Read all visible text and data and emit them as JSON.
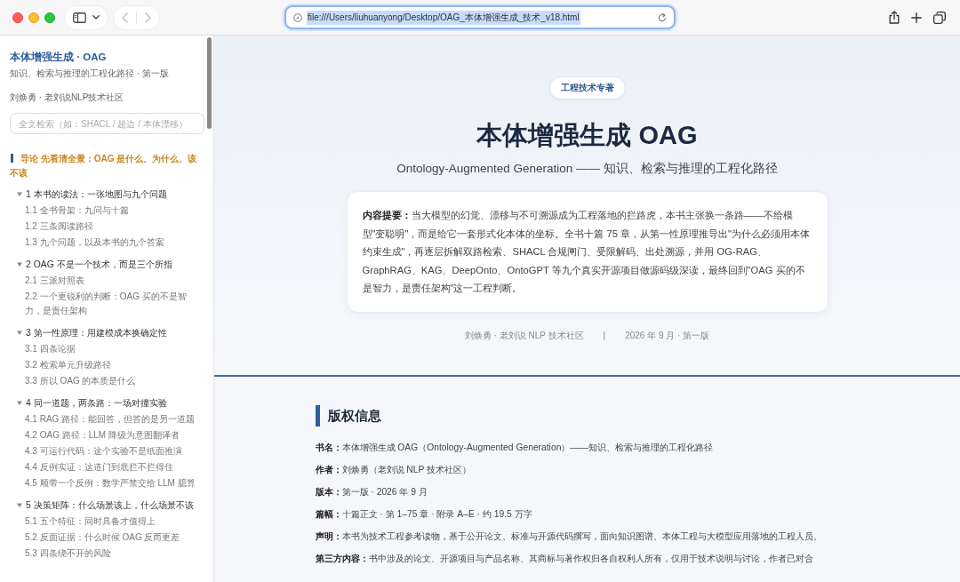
{
  "browser": {
    "url": "file:///Users/liuhuanyong/Desktop/OAG_本体增强生成_技术_v18.html",
    "url_selected": true,
    "back_disabled": true,
    "forward_disabled": true
  },
  "sidebar": {
    "title": "本体增强生成 · OAG",
    "subtitle": "知识、检索与推理的工程化路径 · 第一版",
    "author": "刘焕勇 · 老刘说NLP技术社区",
    "search": {
      "placeholder": "全文检索（如：SHACL / 超边 / 本体漂移）"
    },
    "toc": [
      {
        "kind": "part",
        "label": "导论 先看清全景：OAG 是什么、为什么、该不该",
        "selected": true
      },
      {
        "kind": "chapter",
        "label": "1 本书的读法：一张地图与九个问题",
        "selected": false,
        "expanded": true,
        "children": [
          {
            "label": "1.1 全书骨架：九问与十篇",
            "selected": false
          },
          {
            "label": "1.2 三条阅读路径",
            "selected": false
          },
          {
            "label": "1.3 九个问题，以及本书的九个答案",
            "selected": false
          }
        ]
      },
      {
        "kind": "chapter",
        "label": "2 OAG 不是一个技术，而是三个所指",
        "selected": false,
        "expanded": true,
        "children": [
          {
            "label": "2.1 三派对照表",
            "selected": false
          },
          {
            "label": "2.2 一个更锐利的判断：OAG 买的不是智力，是责任架构",
            "selected": false
          }
        ]
      },
      {
        "kind": "chapter",
        "label": "3 第一性原理：用建模成本换确定性",
        "selected": false,
        "expanded": true,
        "children": [
          {
            "label": "3.1 四条论据",
            "selected": false
          },
          {
            "label": "3.2 检索单元升级路径",
            "selected": false
          },
          {
            "label": "3.3 所以 OAG 的本质是什么",
            "selected": false
          }
        ]
      },
      {
        "kind": "chapter",
        "label": "4 同一道题，两条路：一场对撞实验",
        "selected": false,
        "expanded": true,
        "children": [
          {
            "label": "4.1 RAG 路径：能回答，但答的是另一道题",
            "selected": false
          },
          {
            "label": "4.2 OAG 路径：LLM 降级为意图翻译者",
            "selected": false
          },
          {
            "label": "4.3 可运行代码：这个实验不是纸面推演",
            "selected": false
          },
          {
            "label": "4.4 反例实证：这道门到底拦不拦得住",
            "selected": false
          },
          {
            "label": "4.5 顺带一个反例：数学严禁交给 LLM 臆算",
            "selected": false
          }
        ]
      },
      {
        "kind": "chapter",
        "label": "5 决策矩阵：什么场景该上，什么场景不该",
        "selected": false,
        "expanded": true,
        "children": [
          {
            "label": "5.1 五个特征：同时具备才值得上",
            "selected": false
          },
          {
            "label": "5.2 反面证据：什么时候 OAG 反而更差",
            "selected": false
          },
          {
            "label": "5.3 四条绕不开的风险",
            "selected": false
          }
        ]
      }
    ]
  },
  "hero": {
    "badge": "工程技术专著",
    "title": "本体增强生成 OAG",
    "subtitle": "Ontology-Augmented Generation —— 知识、检索与推理的工程化路径",
    "abstract": "**内容提要：**当大模型的幻觉、漂移与不可溯源成为工程落地的拦路虎，本书主张换一条路——不给模型\"变聪明\"，而是给它一套形式化本体的坐标。全书十篇 75 章，从第一性原理推导出\"为什么必须用本体约束生成\"，再逐层拆解双路检索、SHACL 合规闸门、受限解码、出处溯源，并用 OG-RAG、GraphRAG、KAG、DeepOnto、OntoGPT 等九个真实开源项目做源码级深读，最终回到\"OAG 买的不是智力，是责任架构\"这一工程判断。",
    "meta": [
      "刘焕勇 · 老刘说 NLP 技术社区",
      "|",
      "2026 年 9 月 · 第一版"
    ]
  },
  "copyright": {
    "heading": "版权信息",
    "rows": [
      "**书名：**本体增强生成 OAG（Ontology-Augmented Generation）——知识、检索与推理的工程化路径",
      "**作者：**刘焕勇（老刘说 NLP 技术社区）",
      "**版本：**第一版 · 2026 年 9 月",
      "**篇幅：**十篇正文 · 第 1–75 章 · 附录 A–E · 约 19.5 万字",
      "**声明：**本书为技术工程参考读物，基于公开论文、标准与开源代码撰写，面向知识图谱、本体工程与大模型应用落地的工程人员。",
      "**第三方内容：**书中涉及的论文、开源项目与产品名称、其商标与著作权归各自权利人所有，仅用于技术说明与讨论，作者已对合"
    ]
  }
}
